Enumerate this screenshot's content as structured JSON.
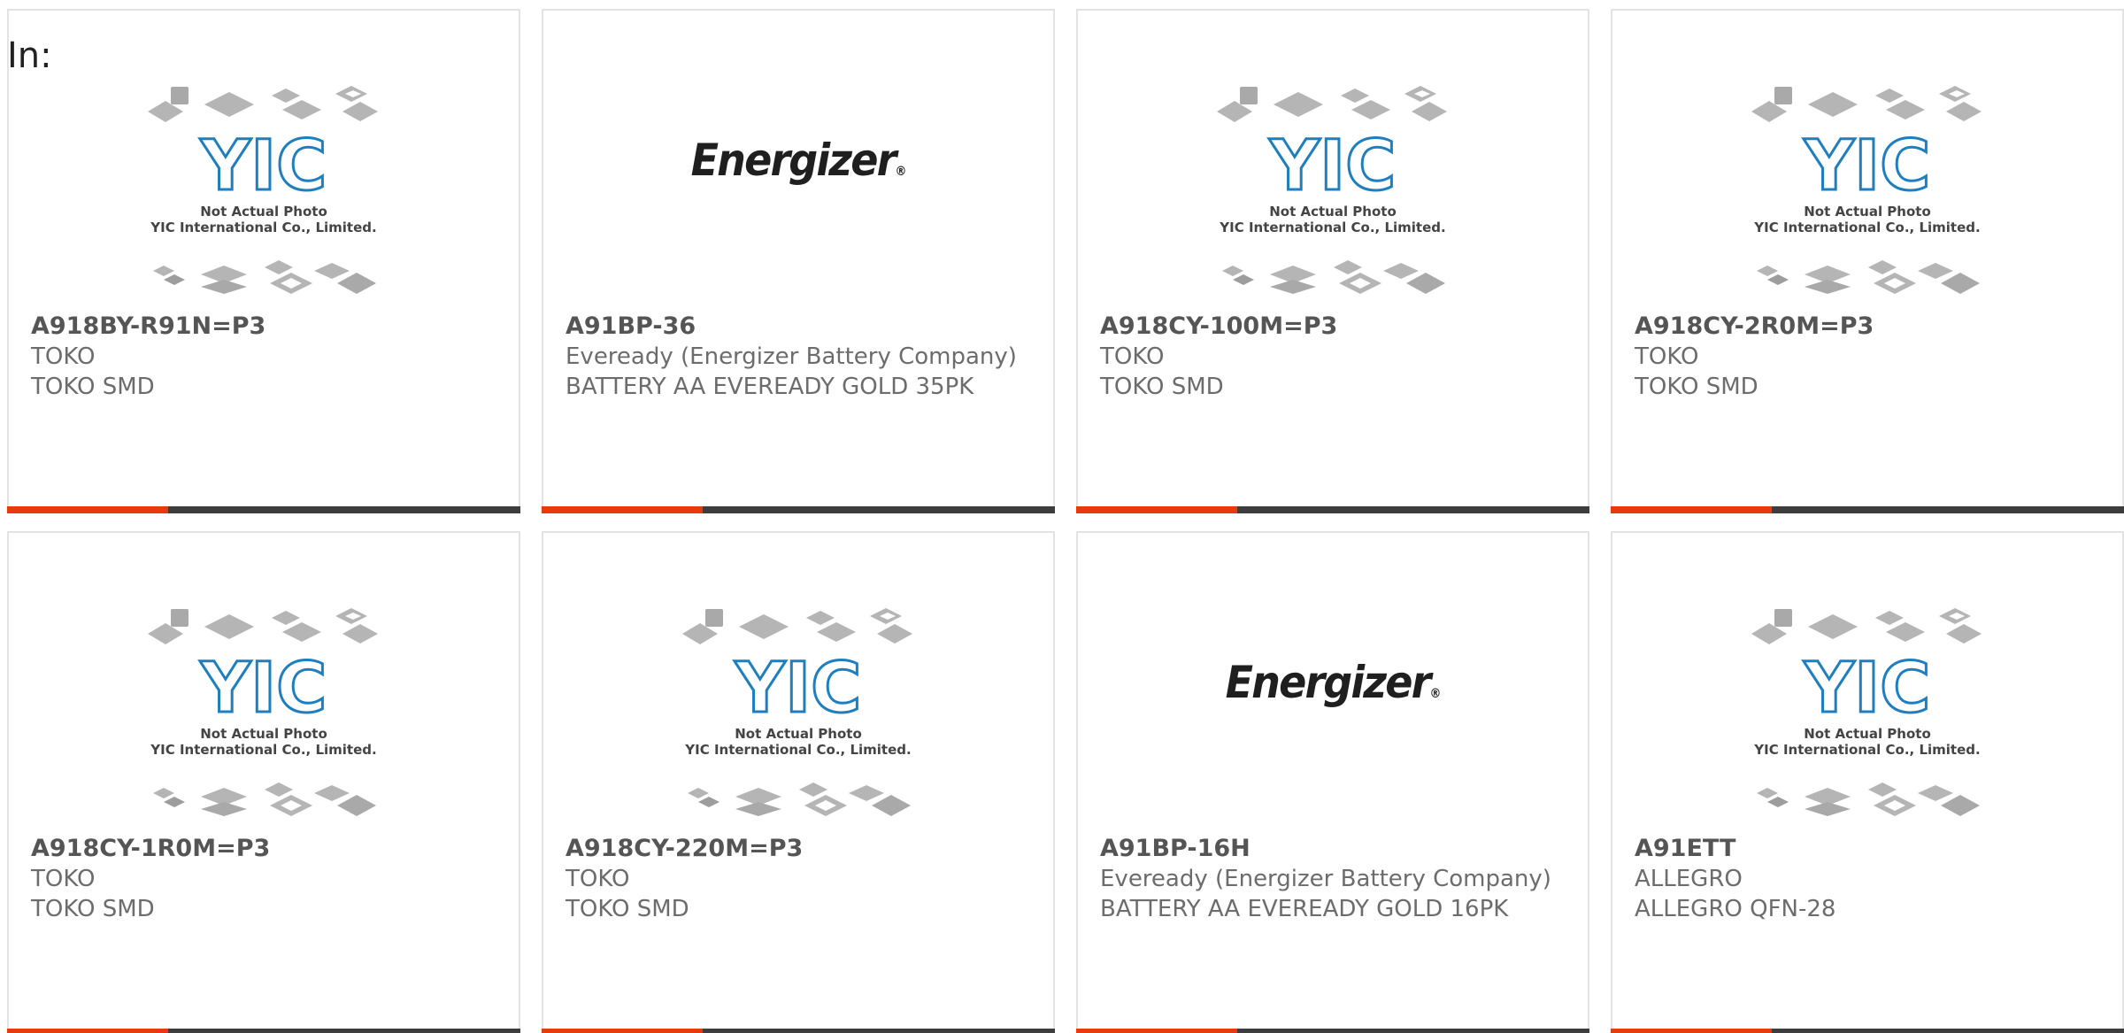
{
  "header": {
    "in_label": "In:"
  },
  "products": [
    {
      "image": "yic",
      "part_no": "A918BY-R91N=P3",
      "manufacturer": "TOKO",
      "description": "TOKO SMD"
    },
    {
      "image": "energizer",
      "part_no": "A91BP-36",
      "manufacturer": "Eveready (Energizer Battery Company)",
      "description": "BATTERY AA EVEREADY GOLD 35PK"
    },
    {
      "image": "yic",
      "part_no": "A918CY-100M=P3",
      "manufacturer": "TOKO",
      "description": "TOKO SMD"
    },
    {
      "image": "yic",
      "part_no": "A918CY-2R0M=P3",
      "manufacturer": "TOKO",
      "description": "TOKO SMD"
    },
    {
      "image": "yic",
      "part_no": "A918CY-1R0M=P3",
      "manufacturer": "TOKO",
      "description": "TOKO SMD"
    },
    {
      "image": "yic",
      "part_no": "A918CY-220M=P3",
      "manufacturer": "TOKO",
      "description": "TOKO SMD"
    },
    {
      "image": "energizer",
      "part_no": "A91BP-16H",
      "manufacturer": "Eveready (Energizer Battery Company)",
      "description": "BATTERY AA EVEREADY GOLD 16PK"
    },
    {
      "image": "yic",
      "part_no": "A91ETT",
      "manufacturer": "ALLEGRO",
      "description": "ALLEGRO QFN-28"
    }
  ],
  "placeholder_image": {
    "caption_line1": "Not Actual Photo",
    "caption_line2": "YIC International Co., Limited.",
    "logo_text": "YIC"
  },
  "energizer_logo": {
    "text": "Energizer",
    "mark": "®"
  },
  "colors": {
    "accent": "#e8390f",
    "bar": "#3d3d3d",
    "yic_blue": "#1e7fc0",
    "chip_gray": "#b5b5b5"
  }
}
